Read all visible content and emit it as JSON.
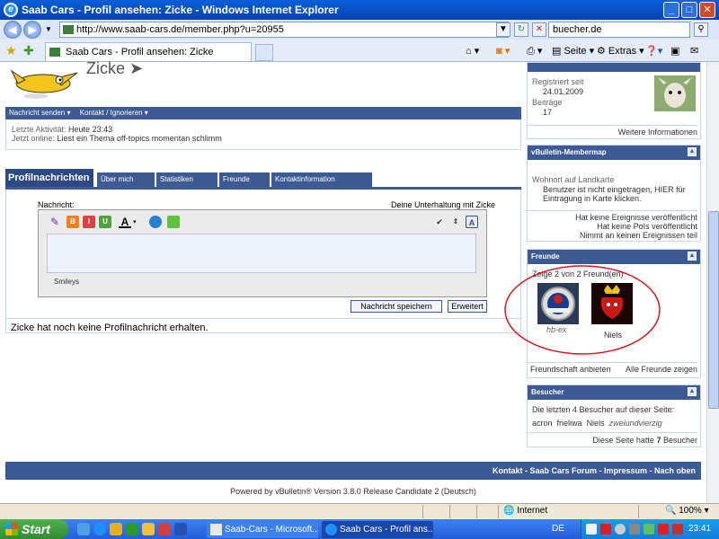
{
  "window": {
    "title": "Saab Cars - Profil ansehen: Zicke - Windows Internet Explorer",
    "minimize": "_",
    "maximize": "□",
    "close": "✕"
  },
  "addressbar": {
    "url": "http://www.saab-cars.de/member.php?u=20955",
    "search_value": "buecher.de"
  },
  "tabs": {
    "active_tab": "Saab Cars - Profil ansehen: Zicke"
  },
  "toolbar": {
    "page_label": "Seite",
    "extras_label": "Extras"
  },
  "profile": {
    "name": "Zicke",
    "nav_send": "Nachricht senden",
    "nav_contact": "Kontakt / Ignorieren",
    "last_activity_label": "Letzte Aktivität:",
    "last_activity_value": "Heute 23:43",
    "online_label": "Jetzt online:",
    "online_value": "Liest ein Thema off-topics momentan schlimm"
  },
  "profile_tabs": [
    {
      "label": "Profilnachrichten"
    },
    {
      "label": "Über mich"
    },
    {
      "label": "Statistiken"
    },
    {
      "label": "Freunde"
    },
    {
      "label": "Kontaktinformation"
    }
  ],
  "message": {
    "label": "Nachricht:",
    "conversation": "Deine Unterhaltung mit Zicke",
    "smileys": "Smileys",
    "save_button": "Nachricht speichern",
    "advanced_button": "Erweitert",
    "no_messages": "Zicke hat noch keine Profilnachricht erhalten."
  },
  "sidebar": {
    "registered_label": "Registriert seit",
    "registered_value": "24.01.2009",
    "posts_label": "Beiträge",
    "posts_value": "17",
    "more_info": "Weitere Informationen",
    "membermap": {
      "title": "vBulletin-Membermap",
      "location_label": "Wohnort auf Landkarte",
      "location_line1": "Benutzer ist nicht eingetragen, HIER für",
      "location_line2": "Eintragung in Karte klicken.",
      "events1": "Hat keine Ereignisse veröffentlicht",
      "events2": "Hat keine PoIs veröffentlicht",
      "events3": "Nimmt an keinen Ereignissen teil"
    },
    "friends": {
      "title": "Freunde",
      "count": "Zeige 2 von 2 Freund(en)",
      "friend1": "hb-ex",
      "friend2": "Niels",
      "offer": "Freundschaft anbieten",
      "all": "Alle Freunde zeigen"
    },
    "visitors": {
      "title": "Besucher",
      "intro": "Die letzten 4 Besucher auf dieser Seite:",
      "v1": "acron",
      "v2": "frieliwa",
      "v3": "Niels",
      "v4": "zweiundvierzig",
      "hits_label": "Diese Seite hatte",
      "hits_value": "7",
      "hits_suffix": "Besucher"
    }
  },
  "footer": {
    "links": "Kontakt - Saab Cars Forum - Impressum - Nach oben",
    "powered": "Powered by vBulletin® Version 3.8.0 Release Candidate 2 (Deutsch)"
  },
  "statusbar": {
    "zone": "Internet",
    "zoom": "100%"
  },
  "taskbar": {
    "start": "Start",
    "task1": "Saab-Cars - Microsoft...",
    "task2": "Saab Cars - Profil ans...",
    "lang": "DE",
    "clock": "23:41"
  }
}
